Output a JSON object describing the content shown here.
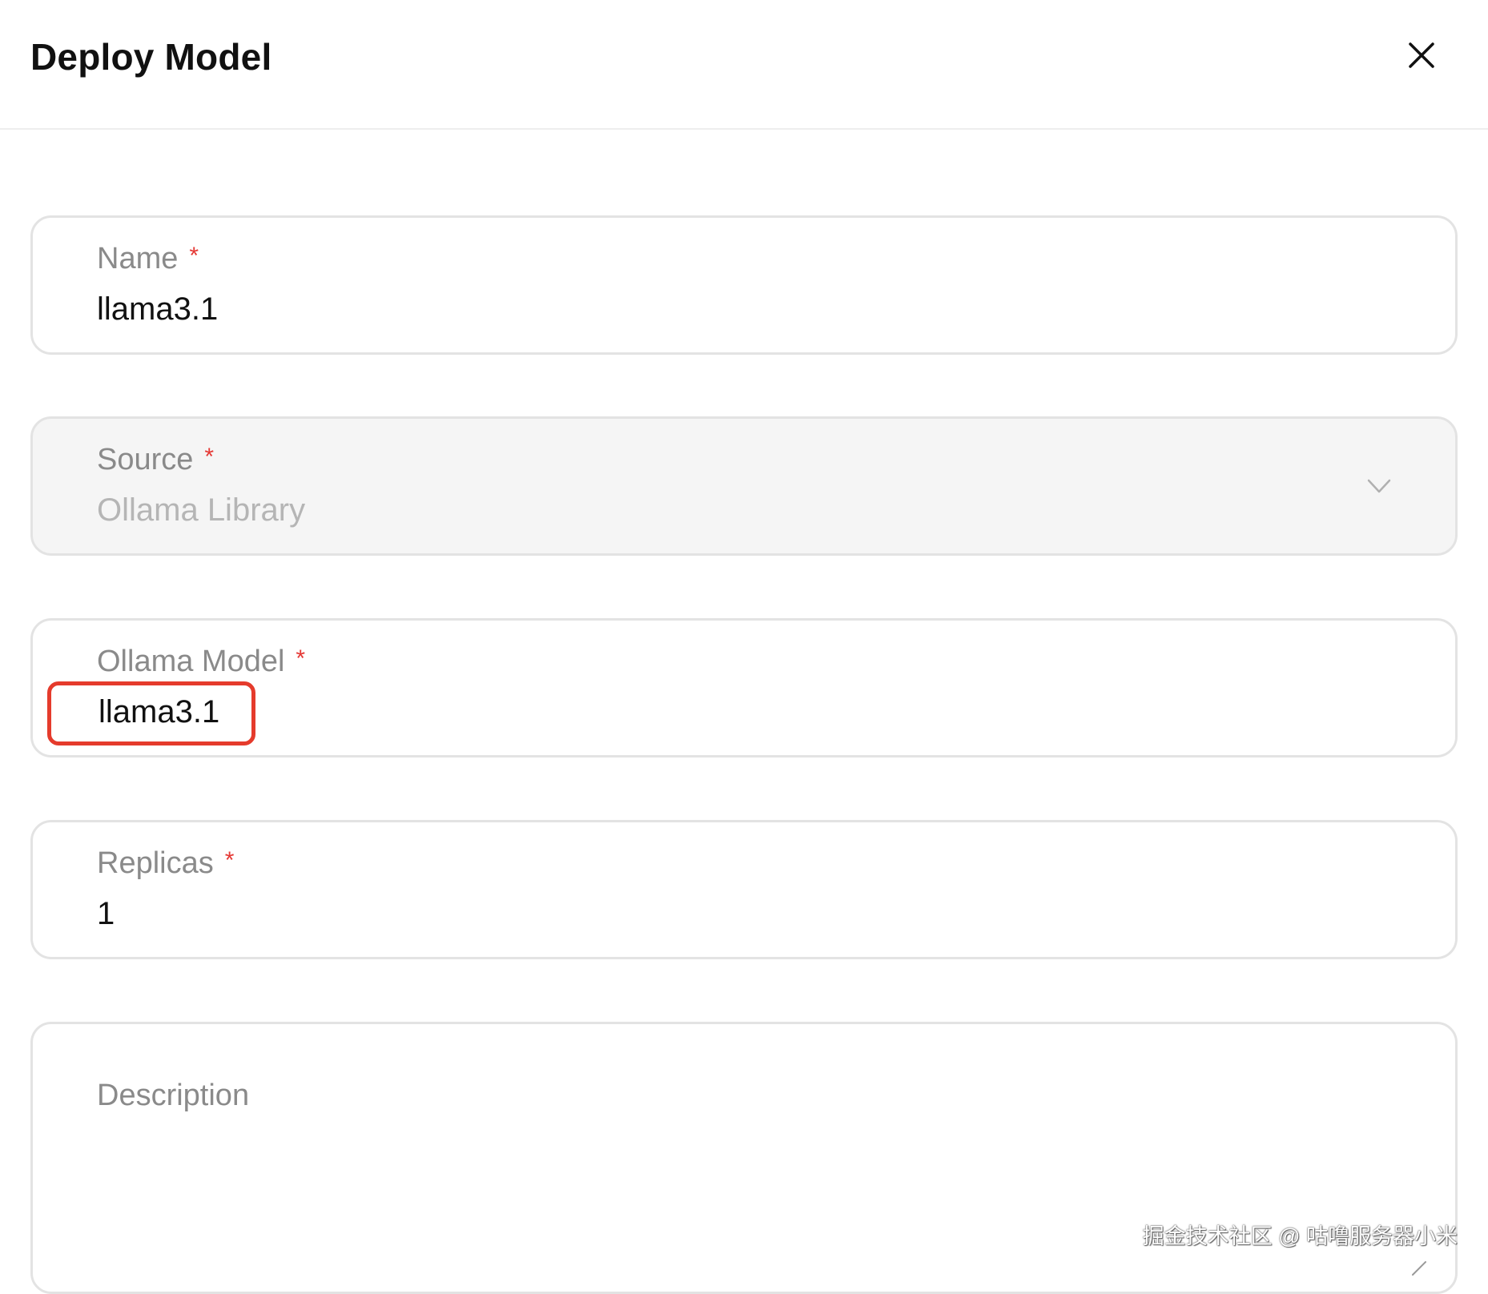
{
  "dialog": {
    "title": "Deploy Model",
    "close_icon": "close-icon"
  },
  "form": {
    "name": {
      "label": "Name",
      "required_mark": "*",
      "value": "llama3.1"
    },
    "source": {
      "label": "Source",
      "required_mark": "*",
      "value": "Ollama Library",
      "disabled": true,
      "icon": "chevron-down-icon"
    },
    "ollama_model": {
      "label": "Ollama Model",
      "required_mark": "*",
      "value": "llama3.1",
      "highlighted": true
    },
    "replicas": {
      "label": "Replicas",
      "required_mark": "*",
      "value": "1"
    },
    "description": {
      "label": "Description",
      "value": ""
    }
  },
  "watermark": "掘金技术社区 @ 咕噜服务器小米",
  "colors": {
    "required": "#e53935",
    "highlight_box": "#e53b2c",
    "field_border": "#e3e3e3",
    "disabled_bg": "#f5f5f5"
  }
}
